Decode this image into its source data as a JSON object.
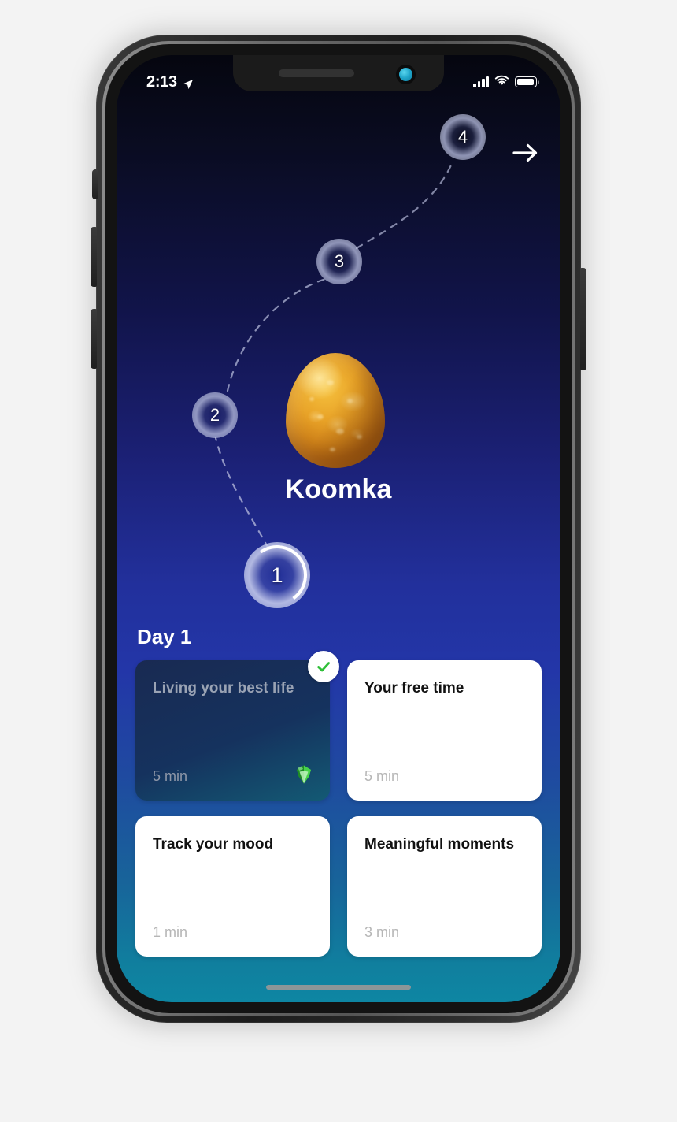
{
  "status_bar": {
    "time": "2:13",
    "location_icon": "location-arrow-icon",
    "cellular_icon": "cellular-signal-icon",
    "wifi_icon": "wifi-icon",
    "battery_icon": "battery-full-icon"
  },
  "top_nav": {
    "next_label": "next-arrow-icon"
  },
  "journey": {
    "nodes": [
      {
        "label": "1",
        "state": "active"
      },
      {
        "label": "2",
        "state": "locked"
      },
      {
        "label": "3",
        "state": "locked"
      },
      {
        "label": "4",
        "state": "locked"
      }
    ]
  },
  "pet": {
    "name": "Koomka",
    "avatar": "golden-egg"
  },
  "day_section": {
    "title": "Day 1",
    "cards": [
      {
        "title": "Living your best life",
        "duration": "5 min",
        "completed": true,
        "reward_icon": "green-gem-icon",
        "style": "completed"
      },
      {
        "title": "Your free time",
        "duration": "5 min",
        "completed": false,
        "style": "light"
      },
      {
        "title": "Track your mood",
        "duration": "1 min",
        "completed": false,
        "style": "light"
      },
      {
        "title": "Meaningful moments",
        "duration": "3 min",
        "completed": false,
        "style": "light"
      }
    ]
  },
  "colors": {
    "accent_top": "#05060f",
    "accent_mid": "#2336a8",
    "accent_bottom": "#0e86a3",
    "check_green": "#2fbf38",
    "gem_green": "#3cc43c",
    "egg_gold": "#e8a227"
  }
}
